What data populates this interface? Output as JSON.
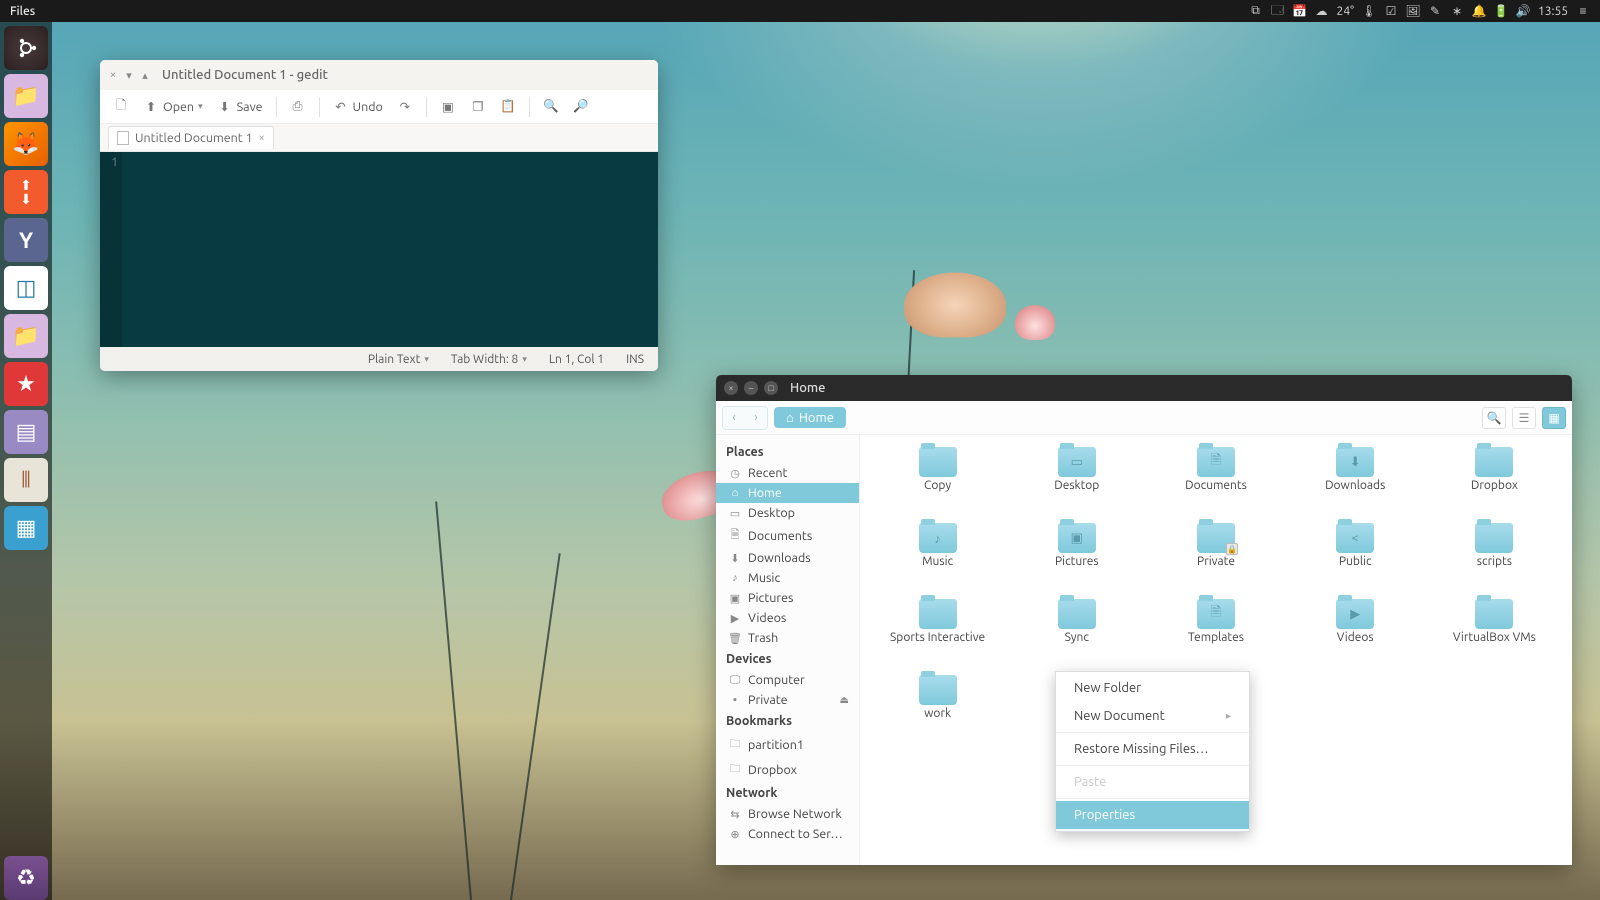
{
  "top_panel": {
    "active_app": "Files",
    "temperature": "24°",
    "clock": "13:55"
  },
  "gedit": {
    "window_title": "Untitled Document 1 - gedit",
    "toolbar": {
      "open": "Open",
      "save": "Save",
      "undo": "Undo"
    },
    "tab_label": "Untitled Document 1",
    "line_number": "1",
    "status": {
      "syntax": "Plain Text",
      "tab_width": "Tab Width: 8",
      "position": "Ln 1, Col 1",
      "insert_mode": "INS"
    }
  },
  "files": {
    "window_title": "Home",
    "path_chip": "Home",
    "sidebar": {
      "places_head": "Places",
      "places": [
        {
          "icon": "◷",
          "label": "Recent"
        },
        {
          "icon": "⌂",
          "label": "Home",
          "active": true
        },
        {
          "icon": "▭",
          "label": "Desktop"
        },
        {
          "icon": "🗎",
          "label": "Documents"
        },
        {
          "icon": "⬇",
          "label": "Downloads"
        },
        {
          "icon": "♪",
          "label": "Music"
        },
        {
          "icon": "▣",
          "label": "Pictures"
        },
        {
          "icon": "▶",
          "label": "Videos"
        },
        {
          "icon": "🗑",
          "label": "Trash"
        }
      ],
      "devices_head": "Devices",
      "devices": [
        {
          "icon": "🖵",
          "label": "Computer"
        },
        {
          "icon": "▪",
          "label": "Private",
          "eject": true
        }
      ],
      "bookmarks_head": "Bookmarks",
      "bookmarks": [
        {
          "icon": "🗀",
          "label": "partition1"
        },
        {
          "icon": "🗀",
          "label": "Dropbox"
        }
      ],
      "network_head": "Network",
      "network": [
        {
          "icon": "⇆",
          "label": "Browse Network"
        },
        {
          "icon": "⊕",
          "label": "Connect to Ser…"
        }
      ]
    },
    "folders": [
      {
        "name": "Copy",
        "glyph": ""
      },
      {
        "name": "Desktop",
        "glyph": "▭"
      },
      {
        "name": "Documents",
        "glyph": "🗎"
      },
      {
        "name": "Downloads",
        "glyph": "⬇"
      },
      {
        "name": "Dropbox",
        "glyph": ""
      },
      {
        "name": "Music",
        "glyph": "♪"
      },
      {
        "name": "Pictures",
        "glyph": "▣"
      },
      {
        "name": "Private",
        "glyph": "",
        "locked": true
      },
      {
        "name": "Public",
        "glyph": "<"
      },
      {
        "name": "scripts",
        "glyph": ""
      },
      {
        "name": "Sports Interactive",
        "glyph": ""
      },
      {
        "name": "Sync",
        "glyph": ""
      },
      {
        "name": "Templates",
        "glyph": "🗎"
      },
      {
        "name": "Videos",
        "glyph": "▶"
      },
      {
        "name": "VirtualBox VMs",
        "glyph": ""
      },
      {
        "name": "work",
        "glyph": ""
      }
    ]
  },
  "context_menu": {
    "new_folder": "New Folder",
    "new_document": "New Document",
    "restore": "Restore Missing Files…",
    "paste": "Paste",
    "properties": "Properties"
  }
}
